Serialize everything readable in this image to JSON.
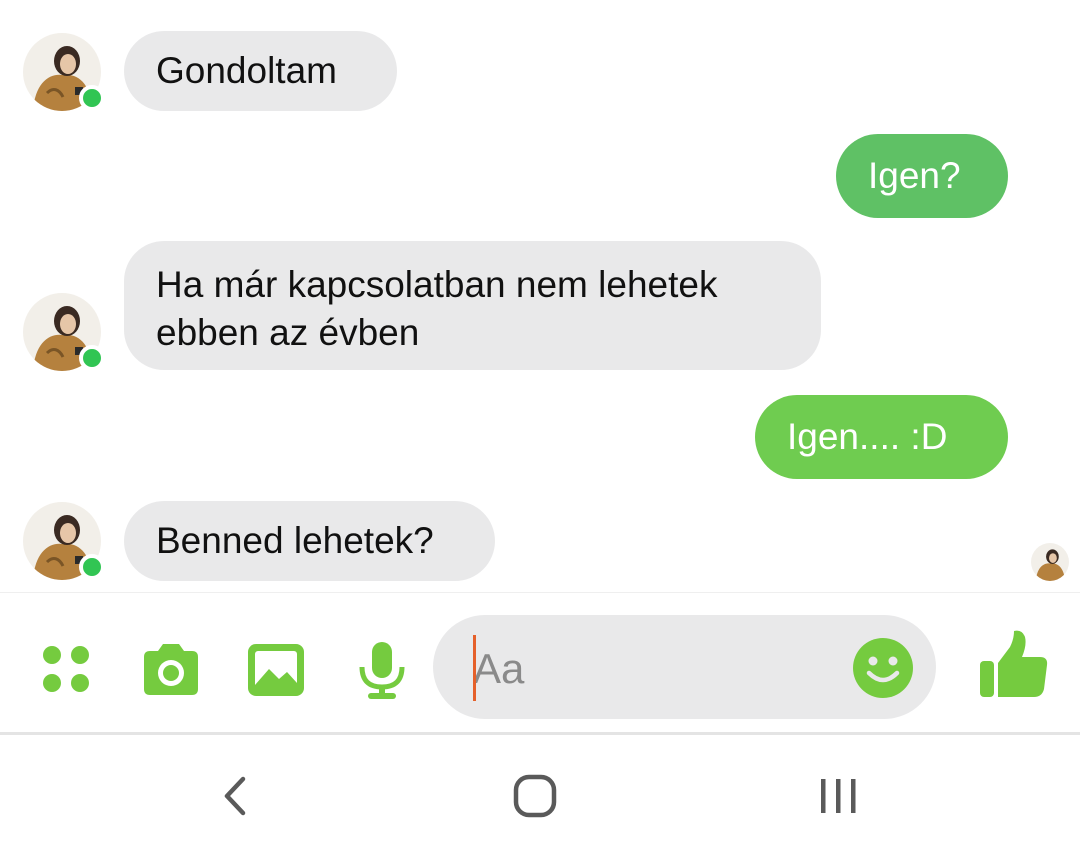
{
  "theme": {
    "accent": "#75cb3f",
    "bubble_out_1": "#5fc165",
    "bubble_out_2": "#6fcc50",
    "bubble_in": "#e9e9ea",
    "online": "#31c553"
  },
  "messages": [
    {
      "direction": "incoming",
      "text": "Gondoltam",
      "avatar": "contact-avatar",
      "online": true
    },
    {
      "direction": "outgoing",
      "text": "Igen?"
    },
    {
      "direction": "incoming",
      "text": "Ha már kapcsolatban nem lehetek ebben az évben",
      "avatar": "contact-avatar",
      "online": true
    },
    {
      "direction": "outgoing",
      "text": "Igen.... :D"
    },
    {
      "direction": "incoming",
      "text": "Benned lehetek?",
      "avatar": "contact-avatar",
      "online": true
    }
  ],
  "composer": {
    "placeholder": "Aa",
    "value": "",
    "tools": [
      "apps-menu-icon",
      "camera-icon",
      "gallery-icon",
      "microphone-icon"
    ],
    "emoji_icon": "smiley-icon",
    "send_icon": "thumbs-up-icon"
  },
  "navbar": {
    "buttons": [
      "back-icon",
      "home-icon",
      "recents-icon"
    ]
  }
}
